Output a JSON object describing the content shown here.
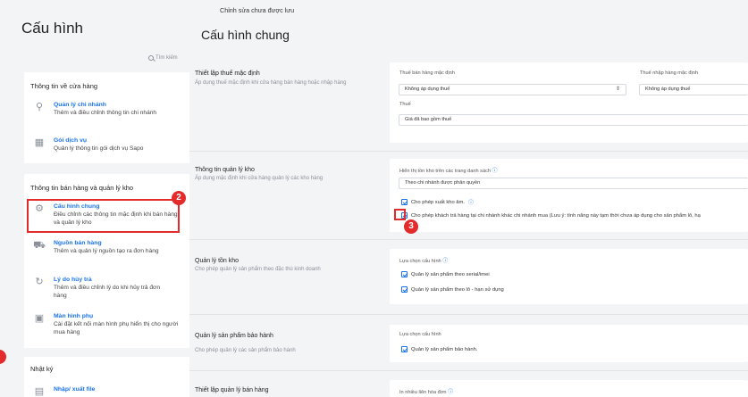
{
  "sidebar": {
    "title": "Cấu hình",
    "search_placeholder": "Tìm kiếm",
    "store_card": {
      "title": "Thông tin về cửa hàng",
      "items": [
        {
          "name": "Quản lý chi nhánh",
          "desc": "Thêm và điều chỉnh thông tin chi nhánh"
        },
        {
          "name": "Gói dịch vụ",
          "desc": "Quản lý thông tin gói dịch vụ Sapo"
        }
      ]
    },
    "sales_card": {
      "title": "Thông tin bán hàng và quản lý kho",
      "items": [
        {
          "name": "Cấu hình chung",
          "desc": "Điều chỉnh các thông tin mặc định khi bán hàng và quản lý kho"
        },
        {
          "name": "Nguồn bán hàng",
          "desc": "Thêm và quản lý nguồn tạo ra đơn hàng"
        },
        {
          "name": "Lý do hủy trả",
          "desc": "Thêm và điều chỉnh lý do khi hủy trả đơn hàng"
        },
        {
          "name": "Màn hình phụ",
          "desc": "Cài đặt kết nối màn hình phụ hiển thị cho người mua hàng"
        }
      ]
    },
    "log_card": {
      "title": "Nhật ký",
      "items": [
        {
          "name": "Nhập/ xuất file",
          "desc": ""
        }
      ]
    },
    "badge_2": "2"
  },
  "main": {
    "unsaved": "Chỉnh sửa chưa được lưu",
    "title": "Cấu hình chung",
    "badge_3": "3",
    "tax": {
      "title": "Thiết lập thuế mặc định",
      "desc": "Áp dụng thuế mặc định khi cửa hàng bán hàng hoặc nhập hàng",
      "sale_tax_label": "Thuế bán hàng mặc định",
      "sale_tax_value": "Không áp dụng thuế",
      "import_tax_label": "Thuế nhập hàng mặc định",
      "import_tax_value": "Không áp dụng thuế",
      "tax_label": "Thuế",
      "tax_value": "Giá đã bao gồm thuế"
    },
    "inventory": {
      "title": "Thông tin quản lý kho",
      "desc": "Áp dụng mặc định khi cửa hàng quản lý các kho hàng",
      "stock_label": "Hiển thị tồn kho trên các trang danh sách",
      "stock_value": "Theo chi nhánh được phân quyền",
      "allow_negative": "Cho phép xuất kho âm.",
      "allow_return": "Cho phép khách trả hàng tại chi nhánh khác chi nhánh mua (Lưu ý: tính năng này tạm thời chưa áp dụng cho sản phẩm lô, hạ"
    },
    "stock_mgmt": {
      "title": "Quản lý tồn kho",
      "desc": "Cho phép quản lý sản phẩm theo đặc thù kinh doanh",
      "label": "Lựa chọn cấu hình",
      "opt1": "Quản lý sản phẩm theo serial/imei",
      "opt2": "Quản lý sản phẩm theo lô - hạn sử dụng"
    },
    "warranty": {
      "title": "Quản lý sản phẩm bảo hành",
      "desc": "Cho phép quản lý các sản phẩm bảo hành",
      "label": "Lựa chọn cấu hình",
      "opt1": "Quản lý sản phẩm bảo hành."
    },
    "sales_mgmt": {
      "title": "Thiết lập quản lý bán hàng",
      "label": "In nhiều liên hóa đơn"
    }
  }
}
